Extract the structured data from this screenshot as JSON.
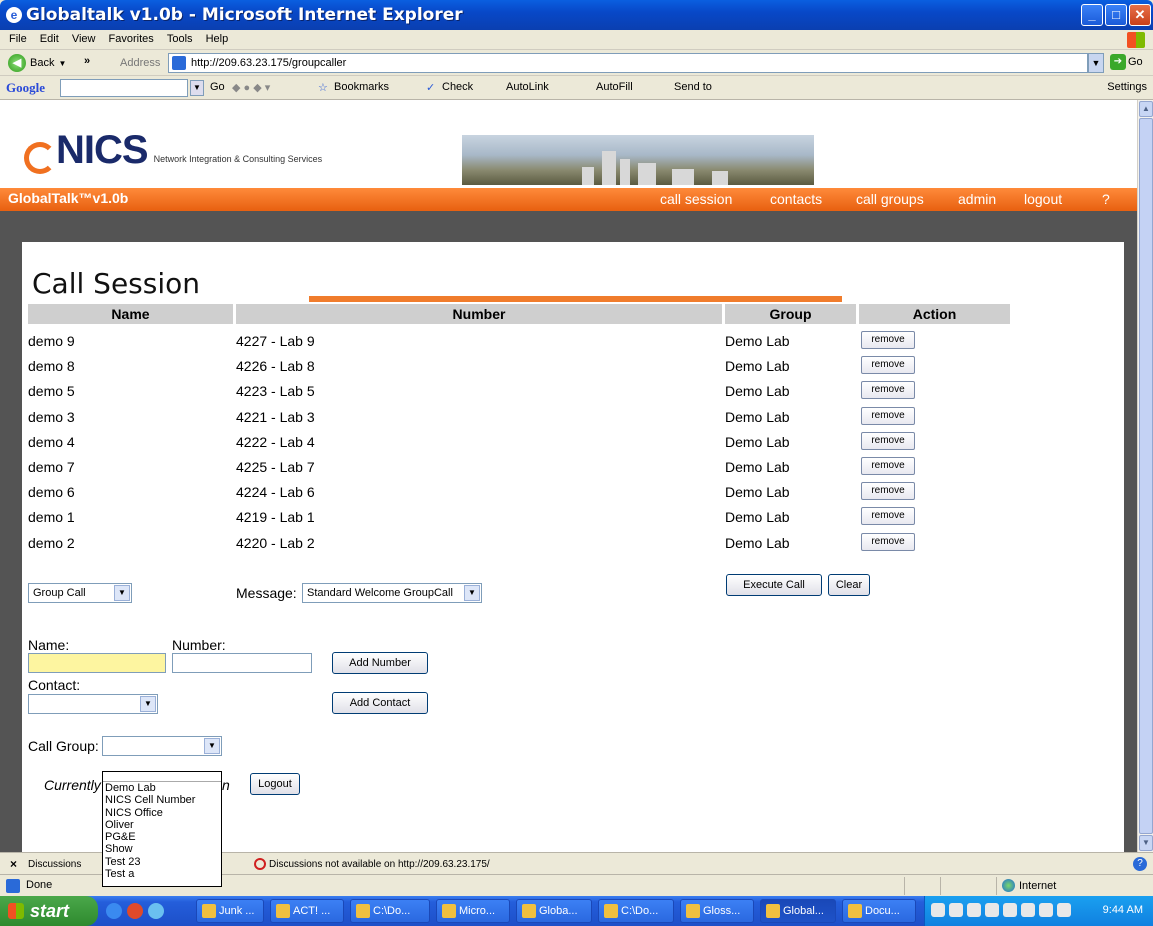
{
  "window": {
    "title": "Globaltalk v1.0b - Microsoft Internet Explorer"
  },
  "menu": [
    "File",
    "Edit",
    "View",
    "Favorites",
    "Tools",
    "Help"
  ],
  "address": {
    "back_label": "Back",
    "label": "Address",
    "url": "http://209.63.23.175/groupcaller",
    "go_label": "Go"
  },
  "googlebar": {
    "logo": "Google",
    "go": "Go",
    "bookmarks": "Bookmarks",
    "check": "Check",
    "autolink": "AutoLink",
    "autofill": "AutoFill",
    "sendto": "Send to",
    "settings": "Settings"
  },
  "site": {
    "logo": "NICS",
    "logo_sub": "Network Integration & Consulting Services",
    "brand": "GlobalTalk™v1.0b",
    "nav": [
      "call session",
      "contacts",
      "call groups",
      "admin",
      "logout",
      "?"
    ]
  },
  "page": {
    "title": "Call Session",
    "columns": [
      "Name",
      "Number",
      "Group",
      "Action"
    ],
    "rows": [
      {
        "name": "demo 9",
        "number": "4227 - Lab 9",
        "group": "Demo Lab",
        "action": "remove"
      },
      {
        "name": "demo 8",
        "number": "4226 - Lab 8",
        "group": "Demo Lab",
        "action": "remove"
      },
      {
        "name": "demo 5",
        "number": "4223 - Lab 5",
        "group": "Demo Lab",
        "action": "remove"
      },
      {
        "name": "demo 3",
        "number": "4221 - Lab 3",
        "group": "Demo Lab",
        "action": "remove"
      },
      {
        "name": "demo 4",
        "number": "4222 - Lab 4",
        "group": "Demo Lab",
        "action": "remove"
      },
      {
        "name": "demo 7",
        "number": "4225 - Lab 7",
        "group": "Demo Lab",
        "action": "remove"
      },
      {
        "name": "demo 6",
        "number": "4224 - Lab 6",
        "group": "Demo Lab",
        "action": "remove"
      },
      {
        "name": "demo 1",
        "number": "4219 - Lab 1",
        "group": "Demo Lab",
        "action": "remove"
      },
      {
        "name": "demo 2",
        "number": "4220 - Lab 2",
        "group": "Demo Lab",
        "action": "remove"
      }
    ],
    "call_type": "Group Call",
    "message_label": "Message:",
    "message_value": "Standard Welcome GroupCall",
    "execute_label": "Execute Call",
    "clear_label": "Clear",
    "name_label": "Name:",
    "number_label": "Number:",
    "add_number_label": "Add Number",
    "contact_label": "Contact:",
    "add_contact_label": "Add Contact",
    "call_group_label": "Call Group:",
    "currently_text": "Currently",
    "currently_tail": "n",
    "logout_label": "Logout",
    "call_group_options": [
      "Demo Lab",
      "NICS Cell Number",
      "NICS Office",
      "Oliver",
      "PG&E",
      "Show",
      "Test 23",
      "Test a"
    ]
  },
  "discussions": {
    "label": "Discussions",
    "message": "Discussions not available on http://209.63.23.175/"
  },
  "status": {
    "done": "Done",
    "zone": "Internet"
  },
  "taskbar": {
    "start": "start",
    "tasks": [
      "Junk ...",
      "ACT! ...",
      "C:\\Do...",
      "Micro...",
      "Globa...",
      "C:\\Do...",
      "Gloss...",
      "Global...",
      "Docu..."
    ],
    "clock": "9:44 AM"
  }
}
